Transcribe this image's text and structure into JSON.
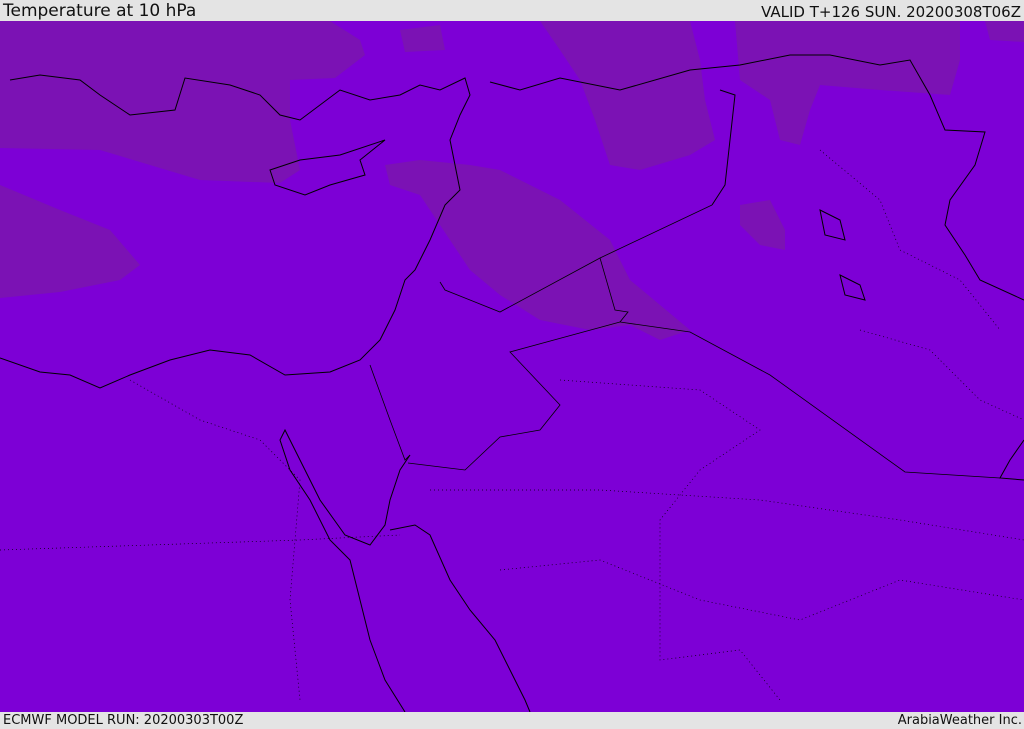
{
  "header": {
    "title": "Temperature at 10 hPa",
    "valid": "VALID T+126 SUN. 20200308T06Z"
  },
  "footer": {
    "model_run": "ECMWF MODEL RUN: 20200303T00Z",
    "credit": "ArabiaWeather Inc."
  },
  "colors": {
    "field_main": "#7d00d6",
    "field_cool": "#7b12b4",
    "coast": "#000000"
  }
}
